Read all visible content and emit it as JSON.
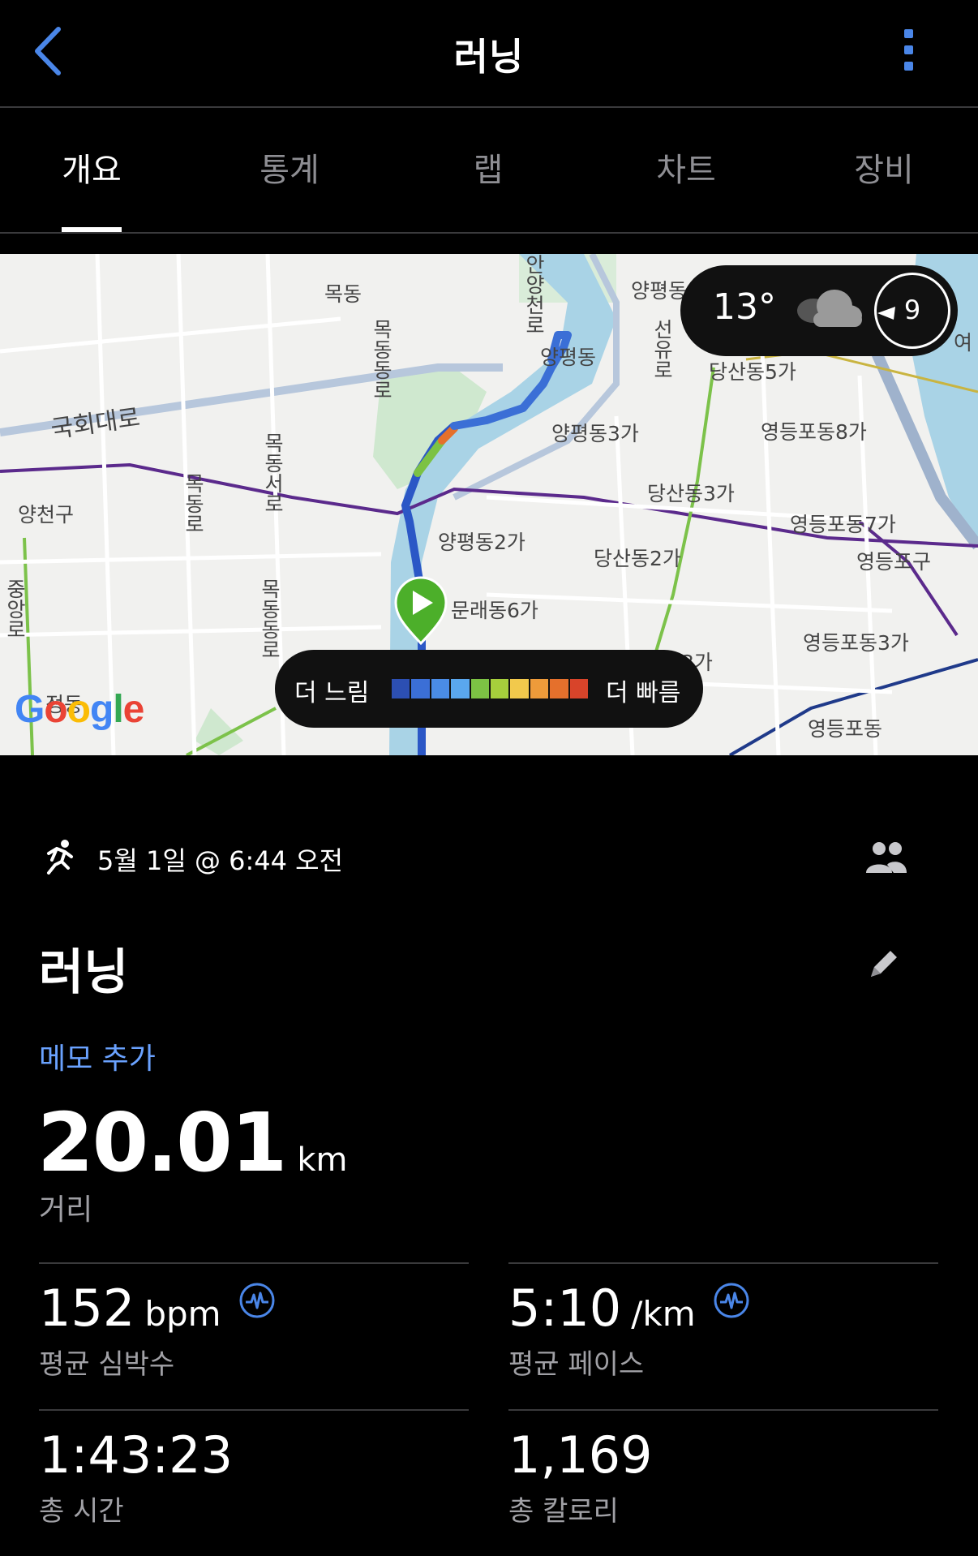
{
  "header": {
    "title": "러닝",
    "back_icon": "chevron-left-icon",
    "more_icon": "more-vertical-icon"
  },
  "tabs": [
    {
      "label": "개요",
      "active": true
    },
    {
      "label": "통계",
      "active": false
    },
    {
      "label": "랩",
      "active": false
    },
    {
      "label": "차트",
      "active": false
    },
    {
      "label": "장비",
      "active": false
    }
  ],
  "map": {
    "labels": [
      "목동",
      "양평동",
      "양평동",
      "양평동3가",
      "당산동5가",
      "영등포동8가",
      "국회대로",
      "당산동3가",
      "양천구",
      "영등포동7가",
      "양평동2가",
      "당산동2가",
      "영등포구",
      "문래동6가",
      "영등포동3가",
      "3가",
      "영등포동",
      "목동동로",
      "목동서로",
      "목동로",
      "안양천로",
      "선유로",
      "목동동로",
      "중앙로",
      "여",
      "정동"
    ],
    "weather": {
      "temperature": "13°",
      "wind_speed": "9",
      "condition_icon": "cloud-icon"
    },
    "legend": {
      "slow": "더 느림",
      "fast": "더 빠름",
      "colors": [
        "#2c4fb3",
        "#3b6fd6",
        "#4a8ce6",
        "#5aa7ee",
        "#7cc244",
        "#a6cf3c",
        "#f2c94c",
        "#ee9b3a",
        "#e5702c",
        "#d8442a"
      ]
    },
    "attribution": "Google",
    "route_color": "#2b57c6",
    "start_marker_color": "#4caf2a"
  },
  "activity": {
    "datetime": "5월 1일 @ 6:44 오전",
    "name": "러닝",
    "memo_link": "메모 추가",
    "distance": {
      "value": "20.01",
      "unit": "km",
      "label": "거리"
    }
  },
  "stats": {
    "heart_rate": {
      "value": "152",
      "unit": "bpm",
      "label": "평균 심박수"
    },
    "pace": {
      "value": "5:10",
      "unit": "/km",
      "label": "평균 페이스"
    },
    "time": {
      "value": "1:43:23",
      "label": "총 시간"
    },
    "calories": {
      "value": "1,169",
      "label": "총 칼로리"
    }
  },
  "colors": {
    "accent": "#4a86e8",
    "link": "#6aa2ff",
    "background": "#000000",
    "divider": "#3a3a3c"
  }
}
